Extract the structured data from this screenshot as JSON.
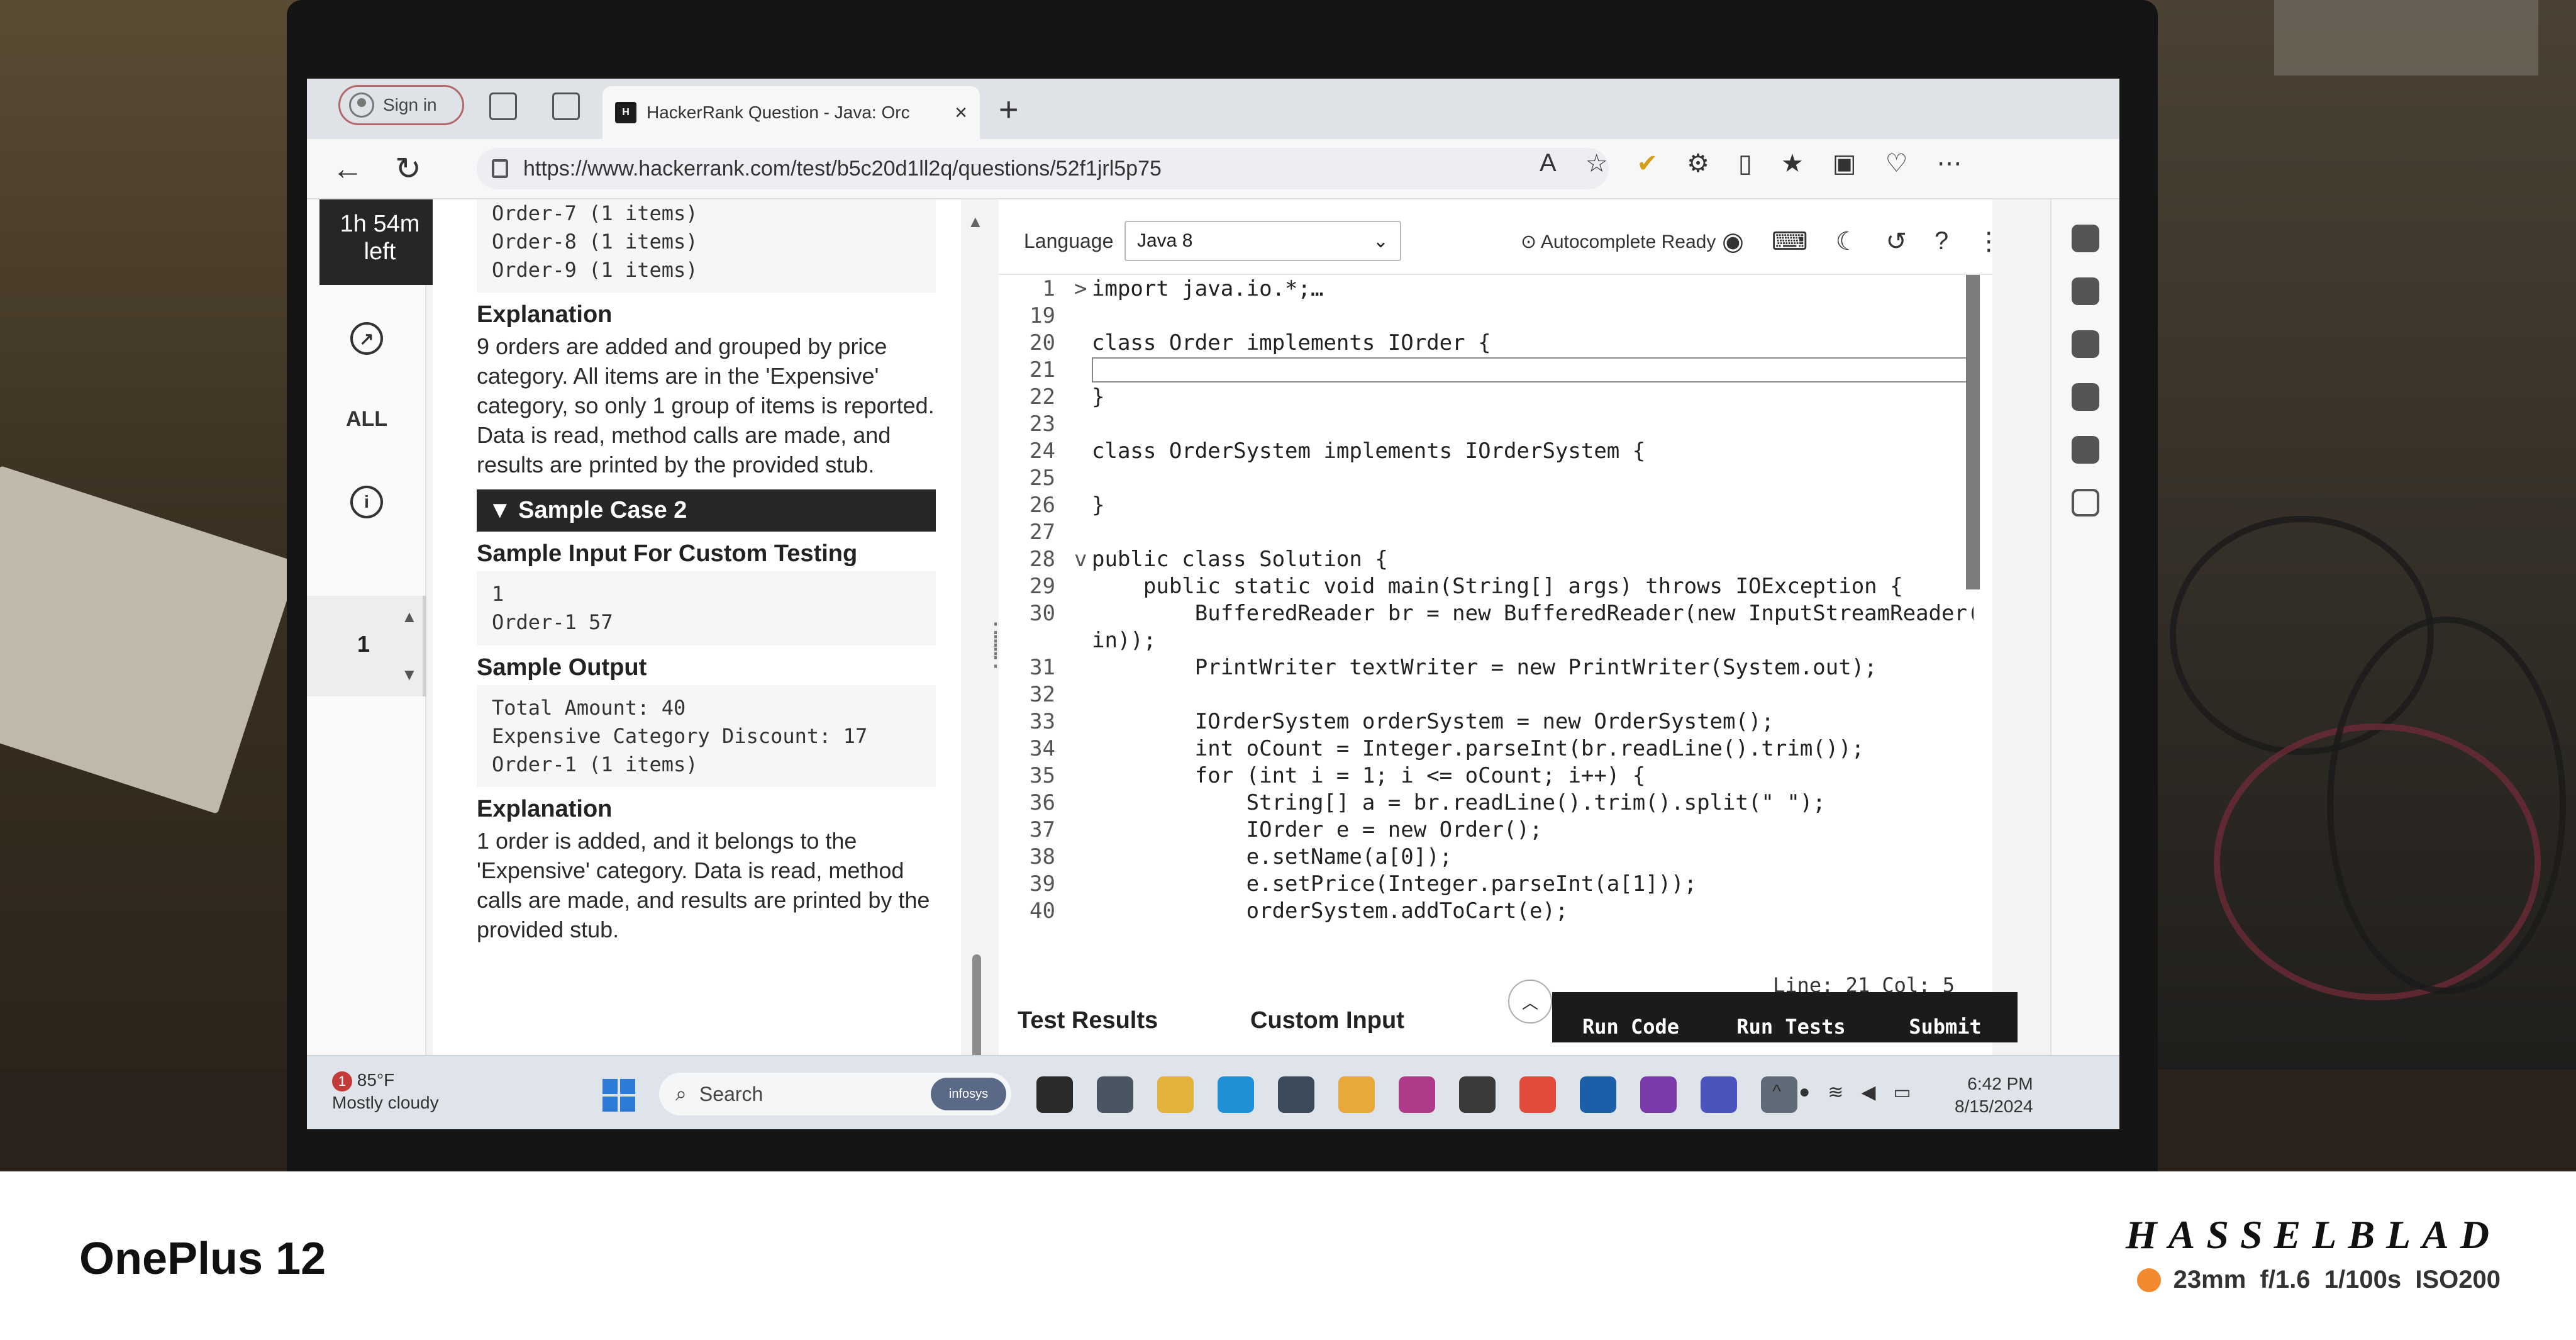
{
  "browser": {
    "signin_label": "Sign in",
    "tab_title": "HackerRank Question - Java: Orc",
    "url": "https://www.hackerrank.com/test/b5c20d1ll2q/questions/52f1jrl5p75"
  },
  "sidebar": {
    "timer_line1": "1h 54m",
    "timer_line2": "left",
    "all_label": "ALL",
    "question_number": "1"
  },
  "problem": {
    "top_output": "Order-7 (1 items)\nOrder-8 (1 items)\nOrder-9 (1 items)",
    "explanation1_heading": "Explanation",
    "explanation1_text": "9 orders are added and grouped by price category. All items are in the 'Expensive' category, so only 1 group of items is reported. Data is read, method calls are made, and results are printed by the provided stub.",
    "case2_heading": "▼ Sample Case 2",
    "sample_input_heading": "Sample Input For Custom Testing",
    "sample_input": "1\nOrder-1 57",
    "sample_output_heading": "Sample Output",
    "sample_output": "Total Amount: 40\nExpensive Category Discount: 17\nOrder-1 (1 items)",
    "explanation2_heading": "Explanation",
    "explanation2_text": "1 order is added, and it belongs to the 'Expensive' category. Data is read, method calls are made, and results are printed by the provided stub."
  },
  "editor": {
    "language_label": "Language",
    "language_value": "Java 8",
    "autocomplete": "Autocomplete Ready",
    "status": "Line: 21 Col: 5",
    "lines": [
      {
        "n": "1",
        "fold": ">",
        "text": "import java.io.*;…"
      },
      {
        "n": "19",
        "fold": "",
        "text": ""
      },
      {
        "n": "20",
        "fold": "",
        "text": "class Order implements IOrder {"
      },
      {
        "n": "21",
        "fold": "",
        "text": ""
      },
      {
        "n": "22",
        "fold": "",
        "text": "}"
      },
      {
        "n": "23",
        "fold": "",
        "text": ""
      },
      {
        "n": "24",
        "fold": "",
        "text": "class OrderSystem implements IOrderSystem {"
      },
      {
        "n": "25",
        "fold": "",
        "text": ""
      },
      {
        "n": "26",
        "fold": "",
        "text": "}"
      },
      {
        "n": "27",
        "fold": "",
        "text": ""
      },
      {
        "n": "28",
        "fold": "v",
        "text": "public class Solution {"
      },
      {
        "n": "29",
        "fold": "",
        "text": "    public static void main(String[] args) throws IOException {"
      },
      {
        "n": "30",
        "fold": "",
        "text": "        BufferedReader br = new BufferedReader(new InputStreamReader(System."
      },
      {
        "n": "",
        "fold": "",
        "text": "in));"
      },
      {
        "n": "31",
        "fold": "",
        "text": "        PrintWriter textWriter = new PrintWriter(System.out);"
      },
      {
        "n": "32",
        "fold": "",
        "text": ""
      },
      {
        "n": "33",
        "fold": "",
        "text": "        IOrderSystem orderSystem = new OrderSystem();"
      },
      {
        "n": "34",
        "fold": "",
        "text": "        int oCount = Integer.parseInt(br.readLine().trim());"
      },
      {
        "n": "35",
        "fold": "",
        "text": "        for (int i = 1; i <= oCount; i++) {"
      },
      {
        "n": "36",
        "fold": "",
        "text": "            String[] a = br.readLine().trim().split(\" \");"
      },
      {
        "n": "37",
        "fold": "",
        "text": "            IOrder e = new Order();"
      },
      {
        "n": "38",
        "fold": "",
        "text": "            e.setName(a[0]);"
      },
      {
        "n": "39",
        "fold": "",
        "text": "            e.setPrice(Integer.parseInt(a[1]));"
      },
      {
        "n": "40",
        "fold": "",
        "text": "            orderSystem.addToCart(e);"
      }
    ],
    "test_results_tab": "Test Results",
    "custom_input_tab": "Custom Input",
    "run_code": "Run Code",
    "run_tests": "Run Tests",
    "submit": "Submit"
  },
  "taskbar": {
    "weather_badge": "1",
    "temperature": "85°F",
    "weather": "Mostly cloudy",
    "search_placeholder": "Search",
    "search_pill": "infosys",
    "time": "6:42 PM",
    "date": "8/15/2024"
  },
  "caption": {
    "device": "OnePlus 12",
    "brand": "HASSELBLAD",
    "specs": "23mm  f/1.6  1/100s  ISO200",
    "accent": "#f2892e"
  }
}
